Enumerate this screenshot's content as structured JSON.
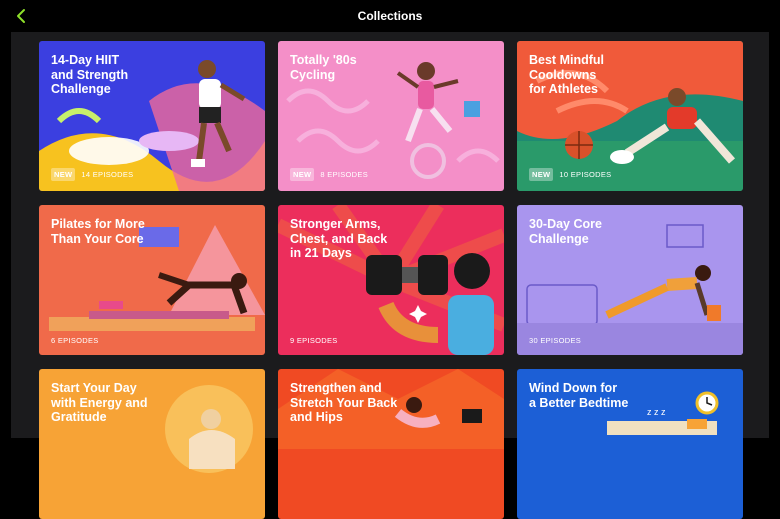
{
  "header": {
    "title": "Collections",
    "back_icon": "chevron-left-icon",
    "accent": "#8ee02a"
  },
  "collections": [
    {
      "title": "14-Day HIIT\nand Strength\nChallenge",
      "badge": "NEW",
      "episodes": "14 EPISODES",
      "bg": "#3b3fe0"
    },
    {
      "title": "Totally '80s\nCycling",
      "badge": "NEW",
      "episodes": "8 EPISODES",
      "bg": "#f48fc8"
    },
    {
      "title": "Best Mindful\nCooldowns\nfor Athletes",
      "badge": "NEW",
      "episodes": "10 EPISODES",
      "bg": "#1f8a72"
    },
    {
      "title": "Pilates for More\nThan Your Core",
      "badge": "",
      "episodes": "6 EPISODES",
      "bg": "#f06a4a"
    },
    {
      "title": "Stronger Arms,\nChest, and Back\nin 21 Days",
      "badge": "",
      "episodes": "9 EPISODES",
      "bg": "#ec2e5c"
    },
    {
      "title": "30-Day Core\nChallenge",
      "badge": "",
      "episodes": "30 EPISODES",
      "bg": "#a995ee"
    },
    {
      "title": "Start Your Day\nwith Energy and\nGratitude",
      "badge": "",
      "episodes": "",
      "bg": "#f7a336"
    },
    {
      "title": "Strengthen and\nStretch Your Back\nand Hips",
      "badge": "",
      "episodes": "",
      "bg": "#f04a23"
    },
    {
      "title": "Wind Down for\na Better Bedtime",
      "badge": "",
      "episodes": "",
      "bg": "#1c5fd6"
    }
  ]
}
